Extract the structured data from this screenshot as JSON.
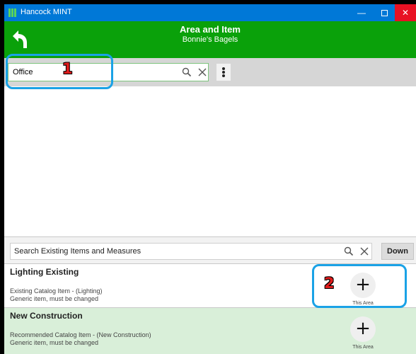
{
  "window": {
    "title": "Hancock MINT",
    "minimize_glyph": "—",
    "close_glyph": "✕"
  },
  "header": {
    "title": "Area and Item",
    "subtitle": "Bonnie's Bagels"
  },
  "search": {
    "value": "Office"
  },
  "existing_search": {
    "placeholder": "Search Existing Items and Measures",
    "down_label": "Down"
  },
  "items": [
    {
      "title": "Lighting Existing",
      "line1": "Existing Catalog Item - (Lighting)",
      "line2": "Generic item, must be changed",
      "action_label": "+",
      "caption": "This Area"
    },
    {
      "title": "New Construction",
      "line1": "Recommended Catalog Item - (New Construction)",
      "line2": "Generic item, must be changed",
      "action_label": "+",
      "caption": "This Area"
    }
  ],
  "annotations": {
    "label1": "1",
    "label2": "2"
  },
  "colors": {
    "titlebar": "#0078d7",
    "header": "#0aa10a",
    "close": "#e81123",
    "highlight_row": "#d9efd9",
    "annotation_box": "#1aa2e6",
    "annotation_number": "#e01c1c"
  }
}
